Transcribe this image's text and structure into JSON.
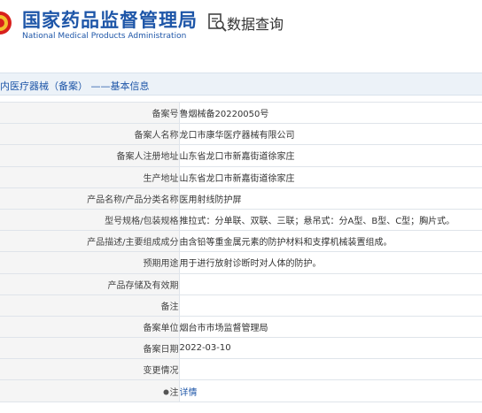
{
  "header": {
    "logo_cn": "国家药品监督管理局",
    "logo_en": "National Medical Products Administration",
    "query_title": "数据查询",
    "query_icon": "search-document-icon",
    "emblem_icon": "national-emblem-icon"
  },
  "breadcrumb": {
    "text": "内医疗器械（备案） ——基本信息"
  },
  "colors": {
    "brand_blue": "#1e56a8",
    "label_bg": "#f5f5f5",
    "crumb_bg": "#ecf2f8"
  },
  "detail": {
    "rows": [
      {
        "label": "备案号",
        "value": "鲁烟械备20220050号"
      },
      {
        "label": "备案人名称",
        "value": "龙口市康华医疗器械有限公司"
      },
      {
        "label": "备案人注册地址",
        "value": "山东省龙口市新嘉街道徐家庄"
      },
      {
        "label": "生产地址",
        "value": "山东省龙口市新嘉街道徐家庄"
      },
      {
        "label": "产品名称/产品分类名称",
        "value": "医用射线防护屏"
      },
      {
        "label": "型号规格/包装规格",
        "value": "推拉式：分单联、双联、三联；悬吊式：分A型、B型、C型；胸片式。"
      },
      {
        "label": "产品描述/主要组成成分",
        "value": "由含铅等重金属元素的防护材料和支撑机械装置组成。"
      },
      {
        "label": "预期用途",
        "value": "用于进行放射诊断时对人体的防护。"
      },
      {
        "label": "产品存储及有效期",
        "value": ""
      },
      {
        "label": "备注",
        "value": ""
      },
      {
        "label": "备案单位",
        "value": "烟台市市场监督管理局"
      },
      {
        "label": "备案日期",
        "value": "2022-03-10"
      },
      {
        "label": "变更情况",
        "value": ""
      }
    ],
    "note_label": "注",
    "note_link": "详情",
    "note_icon": "pin-icon"
  }
}
